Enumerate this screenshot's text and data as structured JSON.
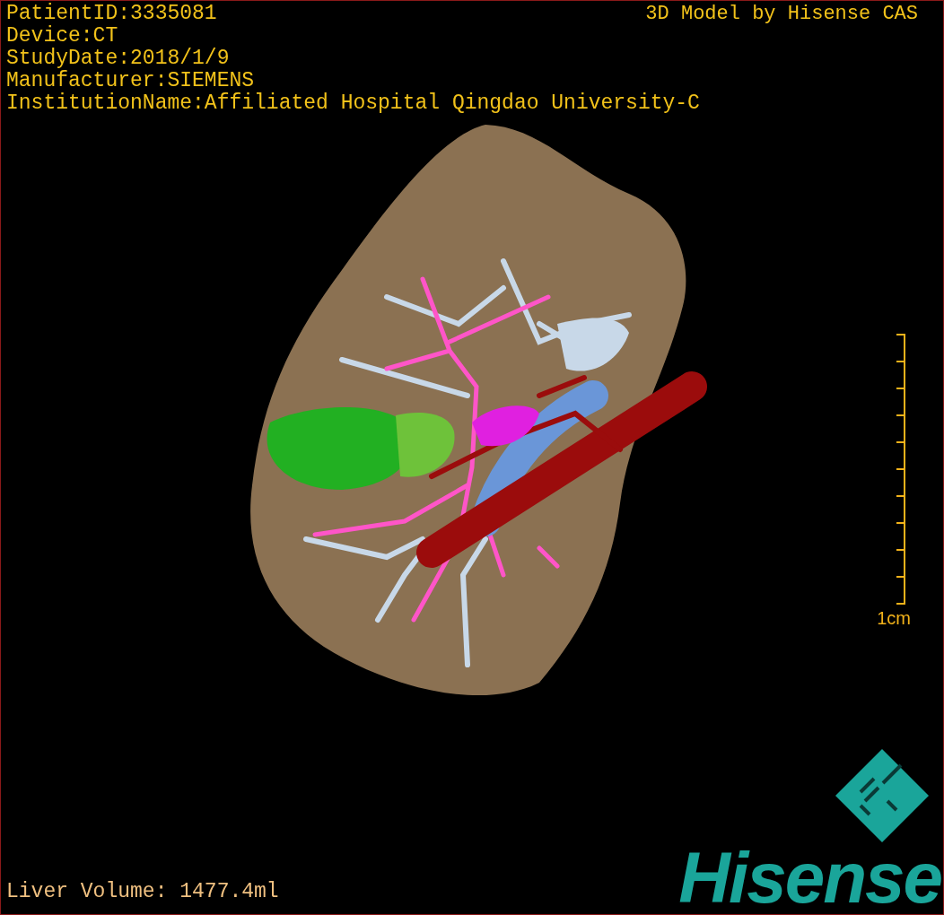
{
  "overlay": {
    "info_lines": [
      "PatientID:3335081",
      "Device:CT",
      "StudyDate:2018/1/9",
      "Manufacturer:SIEMENS",
      "InstitutionName:Affiliated Hospital Qingdao University-C"
    ],
    "title": "3D Model by Hisense CAS"
  },
  "scale_bar": {
    "label": "1cm"
  },
  "volume": "Liver Volume: 1477.4ml",
  "logo": {
    "text": "Hisense"
  }
}
